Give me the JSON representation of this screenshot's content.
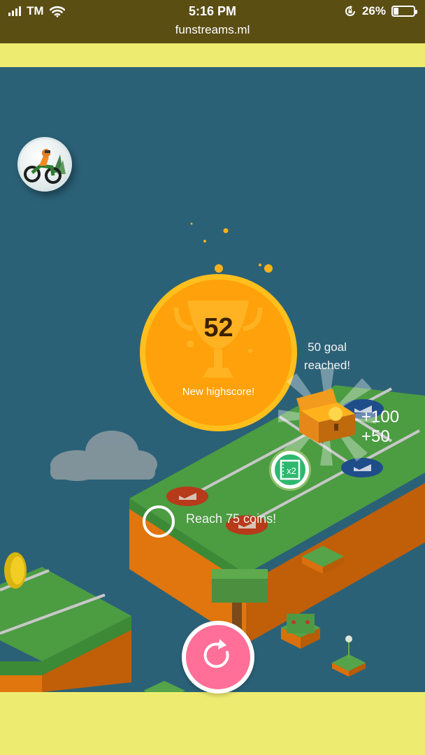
{
  "status_bar": {
    "carrier": "TM",
    "time": "5:16 PM",
    "url": "funstreams.ml",
    "battery": "26%",
    "battery_level": 0.26,
    "icons": [
      "signal-bars-icon",
      "wifi-icon",
      "orientation-lock-icon",
      "battery-icon"
    ]
  },
  "game": {
    "score": "52",
    "score_label": "New highscore!",
    "goal_text": "50 goal reached!",
    "bonus_lines": [
      "+100",
      "+50"
    ],
    "multiplier_badge": "x2",
    "mission_text": "Reach 75 coins!",
    "icons": [
      "motorbike-avatar-icon",
      "trophy-icon",
      "treasure-chest-icon",
      "x2-film-icon",
      "restart-icon"
    ]
  },
  "colors": {
    "status_bar_bg": "#5a4e13",
    "strip_bg": "#eeec70",
    "game_bg": "#2b6177",
    "medal": "#ffa10a",
    "restart_button": "#ff6f98",
    "badge_green": "#2eb86f"
  }
}
